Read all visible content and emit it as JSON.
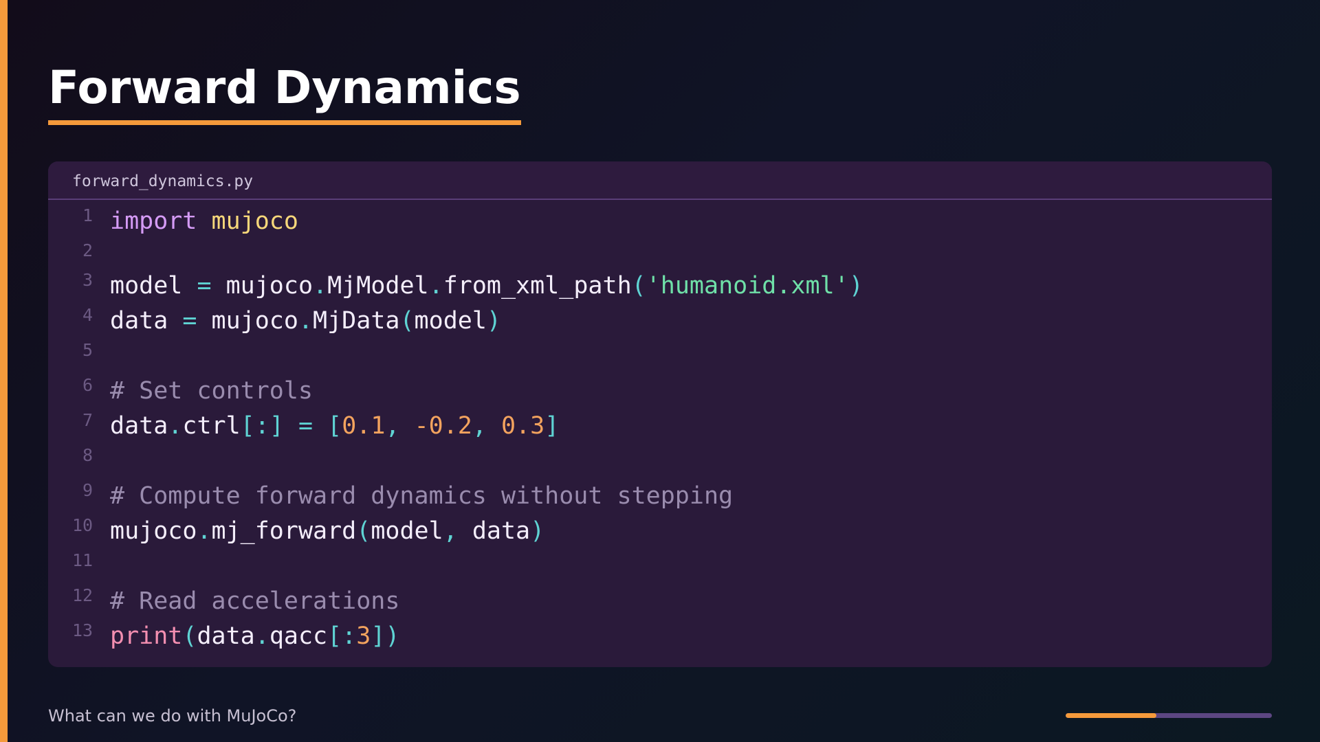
{
  "slide": {
    "title": "Forward Dynamics",
    "footer": "What can we do with MuJoCo?",
    "progress": 0.44
  },
  "colors": {
    "accent": "#f59a3b",
    "keyword": "#d59bf6",
    "module": "#f6d77a",
    "punctuation": "#5fd3d3",
    "string": "#6fe0a8",
    "number": "#f3a35e",
    "comment": "#9a8cae",
    "builtin": "#f48fb1",
    "plain": "#f4eefb",
    "line_number": "#6c5a83"
  },
  "code": {
    "filename": "forward_dynamics.py",
    "lines": [
      {
        "number": "1",
        "tokens": [
          {
            "t": "import",
            "k": "keyword"
          },
          {
            "t": " ",
            "k": "plain"
          },
          {
            "t": "mujoco",
            "k": "module"
          }
        ]
      },
      {
        "number": "2",
        "tokens": []
      },
      {
        "number": "3",
        "tokens": [
          {
            "t": "model ",
            "k": "plain"
          },
          {
            "t": "=",
            "k": "punctuation"
          },
          {
            "t": " mujoco",
            "k": "plain"
          },
          {
            "t": ".",
            "k": "punctuation"
          },
          {
            "t": "MjModel",
            "k": "plain"
          },
          {
            "t": ".",
            "k": "punctuation"
          },
          {
            "t": "from_xml_path",
            "k": "plain"
          },
          {
            "t": "(",
            "k": "punctuation"
          },
          {
            "t": "'humanoid.xml'",
            "k": "string"
          },
          {
            "t": ")",
            "k": "punctuation"
          }
        ]
      },
      {
        "number": "4",
        "tokens": [
          {
            "t": "data ",
            "k": "plain"
          },
          {
            "t": "=",
            "k": "punctuation"
          },
          {
            "t": " mujoco",
            "k": "plain"
          },
          {
            "t": ".",
            "k": "punctuation"
          },
          {
            "t": "MjData",
            "k": "plain"
          },
          {
            "t": "(",
            "k": "punctuation"
          },
          {
            "t": "model",
            "k": "plain"
          },
          {
            "t": ")",
            "k": "punctuation"
          }
        ]
      },
      {
        "number": "5",
        "tokens": []
      },
      {
        "number": "6",
        "tokens": [
          {
            "t": "# Set controls",
            "k": "comment"
          }
        ]
      },
      {
        "number": "7",
        "tokens": [
          {
            "t": "data",
            "k": "plain"
          },
          {
            "t": ".",
            "k": "punctuation"
          },
          {
            "t": "ctrl",
            "k": "plain"
          },
          {
            "t": "[:]",
            "k": "punctuation"
          },
          {
            "t": " ",
            "k": "plain"
          },
          {
            "t": "=",
            "k": "punctuation"
          },
          {
            "t": " ",
            "k": "plain"
          },
          {
            "t": "[",
            "k": "punctuation"
          },
          {
            "t": "0.1",
            "k": "number"
          },
          {
            "t": ", ",
            "k": "punctuation"
          },
          {
            "t": "-0.2",
            "k": "number"
          },
          {
            "t": ", ",
            "k": "punctuation"
          },
          {
            "t": "0.3",
            "k": "number"
          },
          {
            "t": "]",
            "k": "punctuation"
          }
        ]
      },
      {
        "number": "8",
        "tokens": []
      },
      {
        "number": "9",
        "tokens": [
          {
            "t": "# Compute forward dynamics without stepping",
            "k": "comment"
          }
        ]
      },
      {
        "number": "10",
        "tokens": [
          {
            "t": "mujoco",
            "k": "plain"
          },
          {
            "t": ".",
            "k": "punctuation"
          },
          {
            "t": "mj_forward",
            "k": "plain"
          },
          {
            "t": "(",
            "k": "punctuation"
          },
          {
            "t": "model",
            "k": "plain"
          },
          {
            "t": ",",
            "k": "punctuation"
          },
          {
            "t": " data",
            "k": "plain"
          },
          {
            "t": ")",
            "k": "punctuation"
          }
        ]
      },
      {
        "number": "11",
        "tokens": []
      },
      {
        "number": "12",
        "tokens": [
          {
            "t": "# Read accelerations",
            "k": "comment"
          }
        ]
      },
      {
        "number": "13",
        "tokens": [
          {
            "t": "print",
            "k": "builtin"
          },
          {
            "t": "(",
            "k": "punctuation"
          },
          {
            "t": "data",
            "k": "plain"
          },
          {
            "t": ".",
            "k": "punctuation"
          },
          {
            "t": "qacc",
            "k": "plain"
          },
          {
            "t": "[:",
            "k": "punctuation"
          },
          {
            "t": "3",
            "k": "number"
          },
          {
            "t": "])",
            "k": "punctuation"
          }
        ]
      }
    ]
  }
}
